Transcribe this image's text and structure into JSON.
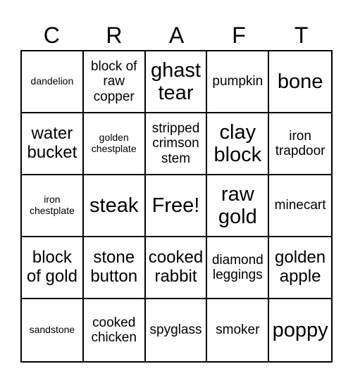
{
  "header": [
    "C",
    "R",
    "A",
    "F",
    "T"
  ],
  "cells": [
    {
      "text": "dandelion",
      "size": "s1"
    },
    {
      "text": "block of raw copper",
      "size": "s2"
    },
    {
      "text": "ghast tear",
      "size": "s4"
    },
    {
      "text": "pumpkin",
      "size": "s2"
    },
    {
      "text": "bone",
      "size": "s4"
    },
    {
      "text": "water bucket",
      "size": "s3"
    },
    {
      "text": "golden chestplate",
      "size": "s1"
    },
    {
      "text": "stripped crimson stem",
      "size": "s2"
    },
    {
      "text": "clay block",
      "size": "s4"
    },
    {
      "text": "iron trapdoor",
      "size": "s2"
    },
    {
      "text": "iron chestplate",
      "size": "s1"
    },
    {
      "text": "steak",
      "size": "s4"
    },
    {
      "text": "Free!",
      "size": "s4"
    },
    {
      "text": "raw gold",
      "size": "s4"
    },
    {
      "text": "minecart",
      "size": "s2"
    },
    {
      "text": "block of gold",
      "size": "s3"
    },
    {
      "text": "stone button",
      "size": "s3"
    },
    {
      "text": "cooked rabbit",
      "size": "s3"
    },
    {
      "text": "diamond leggings",
      "size": "s2"
    },
    {
      "text": "golden apple",
      "size": "s3"
    },
    {
      "text": "sandstone",
      "size": "s1"
    },
    {
      "text": "cooked chicken",
      "size": "s2"
    },
    {
      "text": "spyglass",
      "size": "s2"
    },
    {
      "text": "smoker",
      "size": "s2"
    },
    {
      "text": "poppy",
      "size": "s4"
    }
  ]
}
